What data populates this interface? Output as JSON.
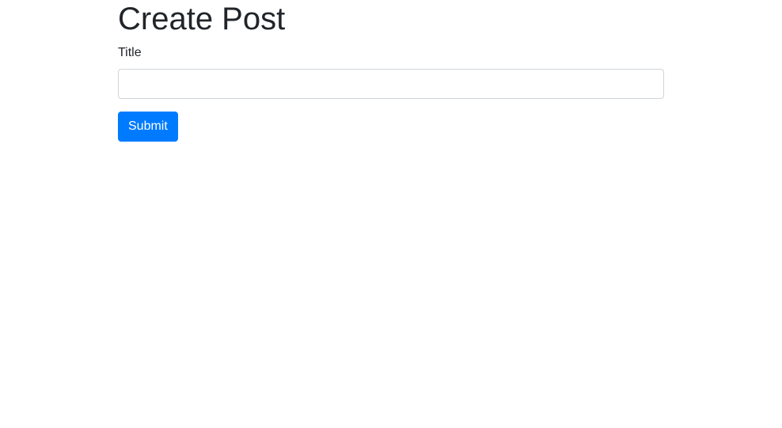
{
  "page": {
    "title": "Create Post"
  },
  "form": {
    "title_label": "Title",
    "title_value": "",
    "title_placeholder": "",
    "submit_label": "Submit"
  },
  "colors": {
    "primary": "#007bff",
    "text": "#212529",
    "input_border": "#ced4da"
  }
}
